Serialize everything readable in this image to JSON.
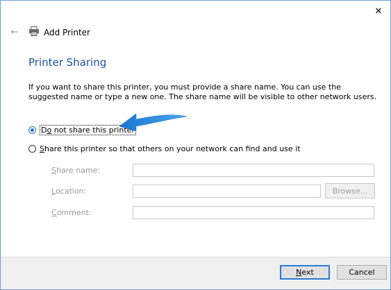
{
  "window": {
    "title": "Add Printer",
    "close_label": "✕",
    "back_label": "←"
  },
  "page": {
    "heading": "Printer Sharing",
    "description": "If you want to share this printer, you must provide a share name. You can use the suggested name or type a new one. The share name will be visible to other network users."
  },
  "options": {
    "no_share": {
      "pre": "D",
      "accel": "o",
      "post": " not share this printer",
      "checked": true
    },
    "share": {
      "pre": "",
      "accel": "S",
      "post": "hare this printer so that others on your network can find and use it",
      "checked": false
    }
  },
  "fields": {
    "share_name": {
      "accel": "S",
      "post": "hare name:",
      "value": ""
    },
    "location": {
      "accel": "L",
      "post": "ocation:",
      "value": ""
    },
    "comment": {
      "accel": "C",
      "post": "omment:",
      "value": ""
    },
    "browse_label": "Browse..."
  },
  "footer": {
    "next": {
      "accel": "N",
      "post": "ext"
    },
    "cancel_label": "Cancel"
  },
  "colors": {
    "accent": "#1c6fd1",
    "heading": "#1c4fa0",
    "annotation_arrow": "#2a8ee0"
  },
  "icons": {
    "back": "back-arrow-icon",
    "printer": "printer-icon",
    "close": "close-icon"
  }
}
